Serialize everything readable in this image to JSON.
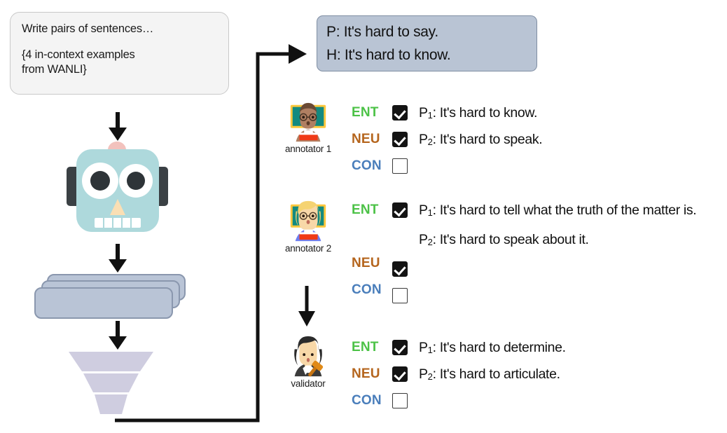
{
  "prompt": {
    "line1": "Write pairs of sentences…",
    "line2": "{4 in-context examples",
    "line3": "from WANLI}"
  },
  "pipeline": {
    "robot_icon": "robot-icon",
    "cards_icon": "stacked-cards-icon",
    "funnel_icon": "funnel-icon",
    "arrow_prompt_to_robot": "down-arrow-icon",
    "arrow_robot_to_cards": "down-arrow-icon",
    "arrow_cards_to_funnel": "down-arrow-icon",
    "feedback_arrow": "feedback-loop-arrow-icon"
  },
  "example_pair": {
    "premise": "P: It's hard to say.",
    "hypothesis": "H: It's hard to know."
  },
  "label_colors": {
    "entailment": "#4CC247",
    "neutral": "#B5651D",
    "contradiction": "#4A7EBB"
  },
  "labels": {
    "ent": "ENT",
    "neu": "NEU",
    "con": "CON"
  },
  "annotators": [
    {
      "role": "annotator 1",
      "avatar": "teacher-man-icon",
      "rows": [
        {
          "label": "ENT",
          "checked": true,
          "sentence_prefix": "P",
          "sentence_index": "1",
          "sentence": ": It's hard to know."
        },
        {
          "label": "NEU",
          "checked": true,
          "sentence_prefix": "P",
          "sentence_index": "2",
          "sentence": ": It's hard to speak."
        },
        {
          "label": "CON",
          "checked": false,
          "sentence_prefix": "",
          "sentence_index": "",
          "sentence": ""
        }
      ]
    },
    {
      "role": "annotator 2",
      "avatar": "teacher-woman-icon",
      "rows": [
        {
          "label": "ENT",
          "checked": true,
          "sentence_prefix": "P",
          "sentence_index": "1",
          "sentence": ": It's hard to tell what the truth of the matter is."
        },
        {
          "label": "NEU",
          "checked": true,
          "sentence_prefix": "P",
          "sentence_index": "2",
          "sentence": ": It's hard to speak about it."
        },
        {
          "label": "CON",
          "checked": false,
          "sentence_prefix": "",
          "sentence_index": "",
          "sentence": ""
        }
      ]
    },
    {
      "role": "validator",
      "avatar": "judge-woman-icon",
      "rows": [
        {
          "label": "ENT",
          "checked": true,
          "sentence_prefix": "P",
          "sentence_index": "1",
          "sentence": ": It's hard to determine."
        },
        {
          "label": "NEU",
          "checked": true,
          "sentence_prefix": "P",
          "sentence_index": "2",
          "sentence": ": It's hard to articulate."
        },
        {
          "label": "CON",
          "checked": false,
          "sentence_prefix": "",
          "sentence_index": "",
          "sentence": ""
        }
      ]
    }
  ],
  "colors": {
    "prompt_bg": "#f4f4f4",
    "pair_box_bg": "#b9c4d4",
    "cards_fill": "#b9c4d6",
    "funnel_fill": "#cfcde0",
    "robot_head": "#aed9dc"
  }
}
